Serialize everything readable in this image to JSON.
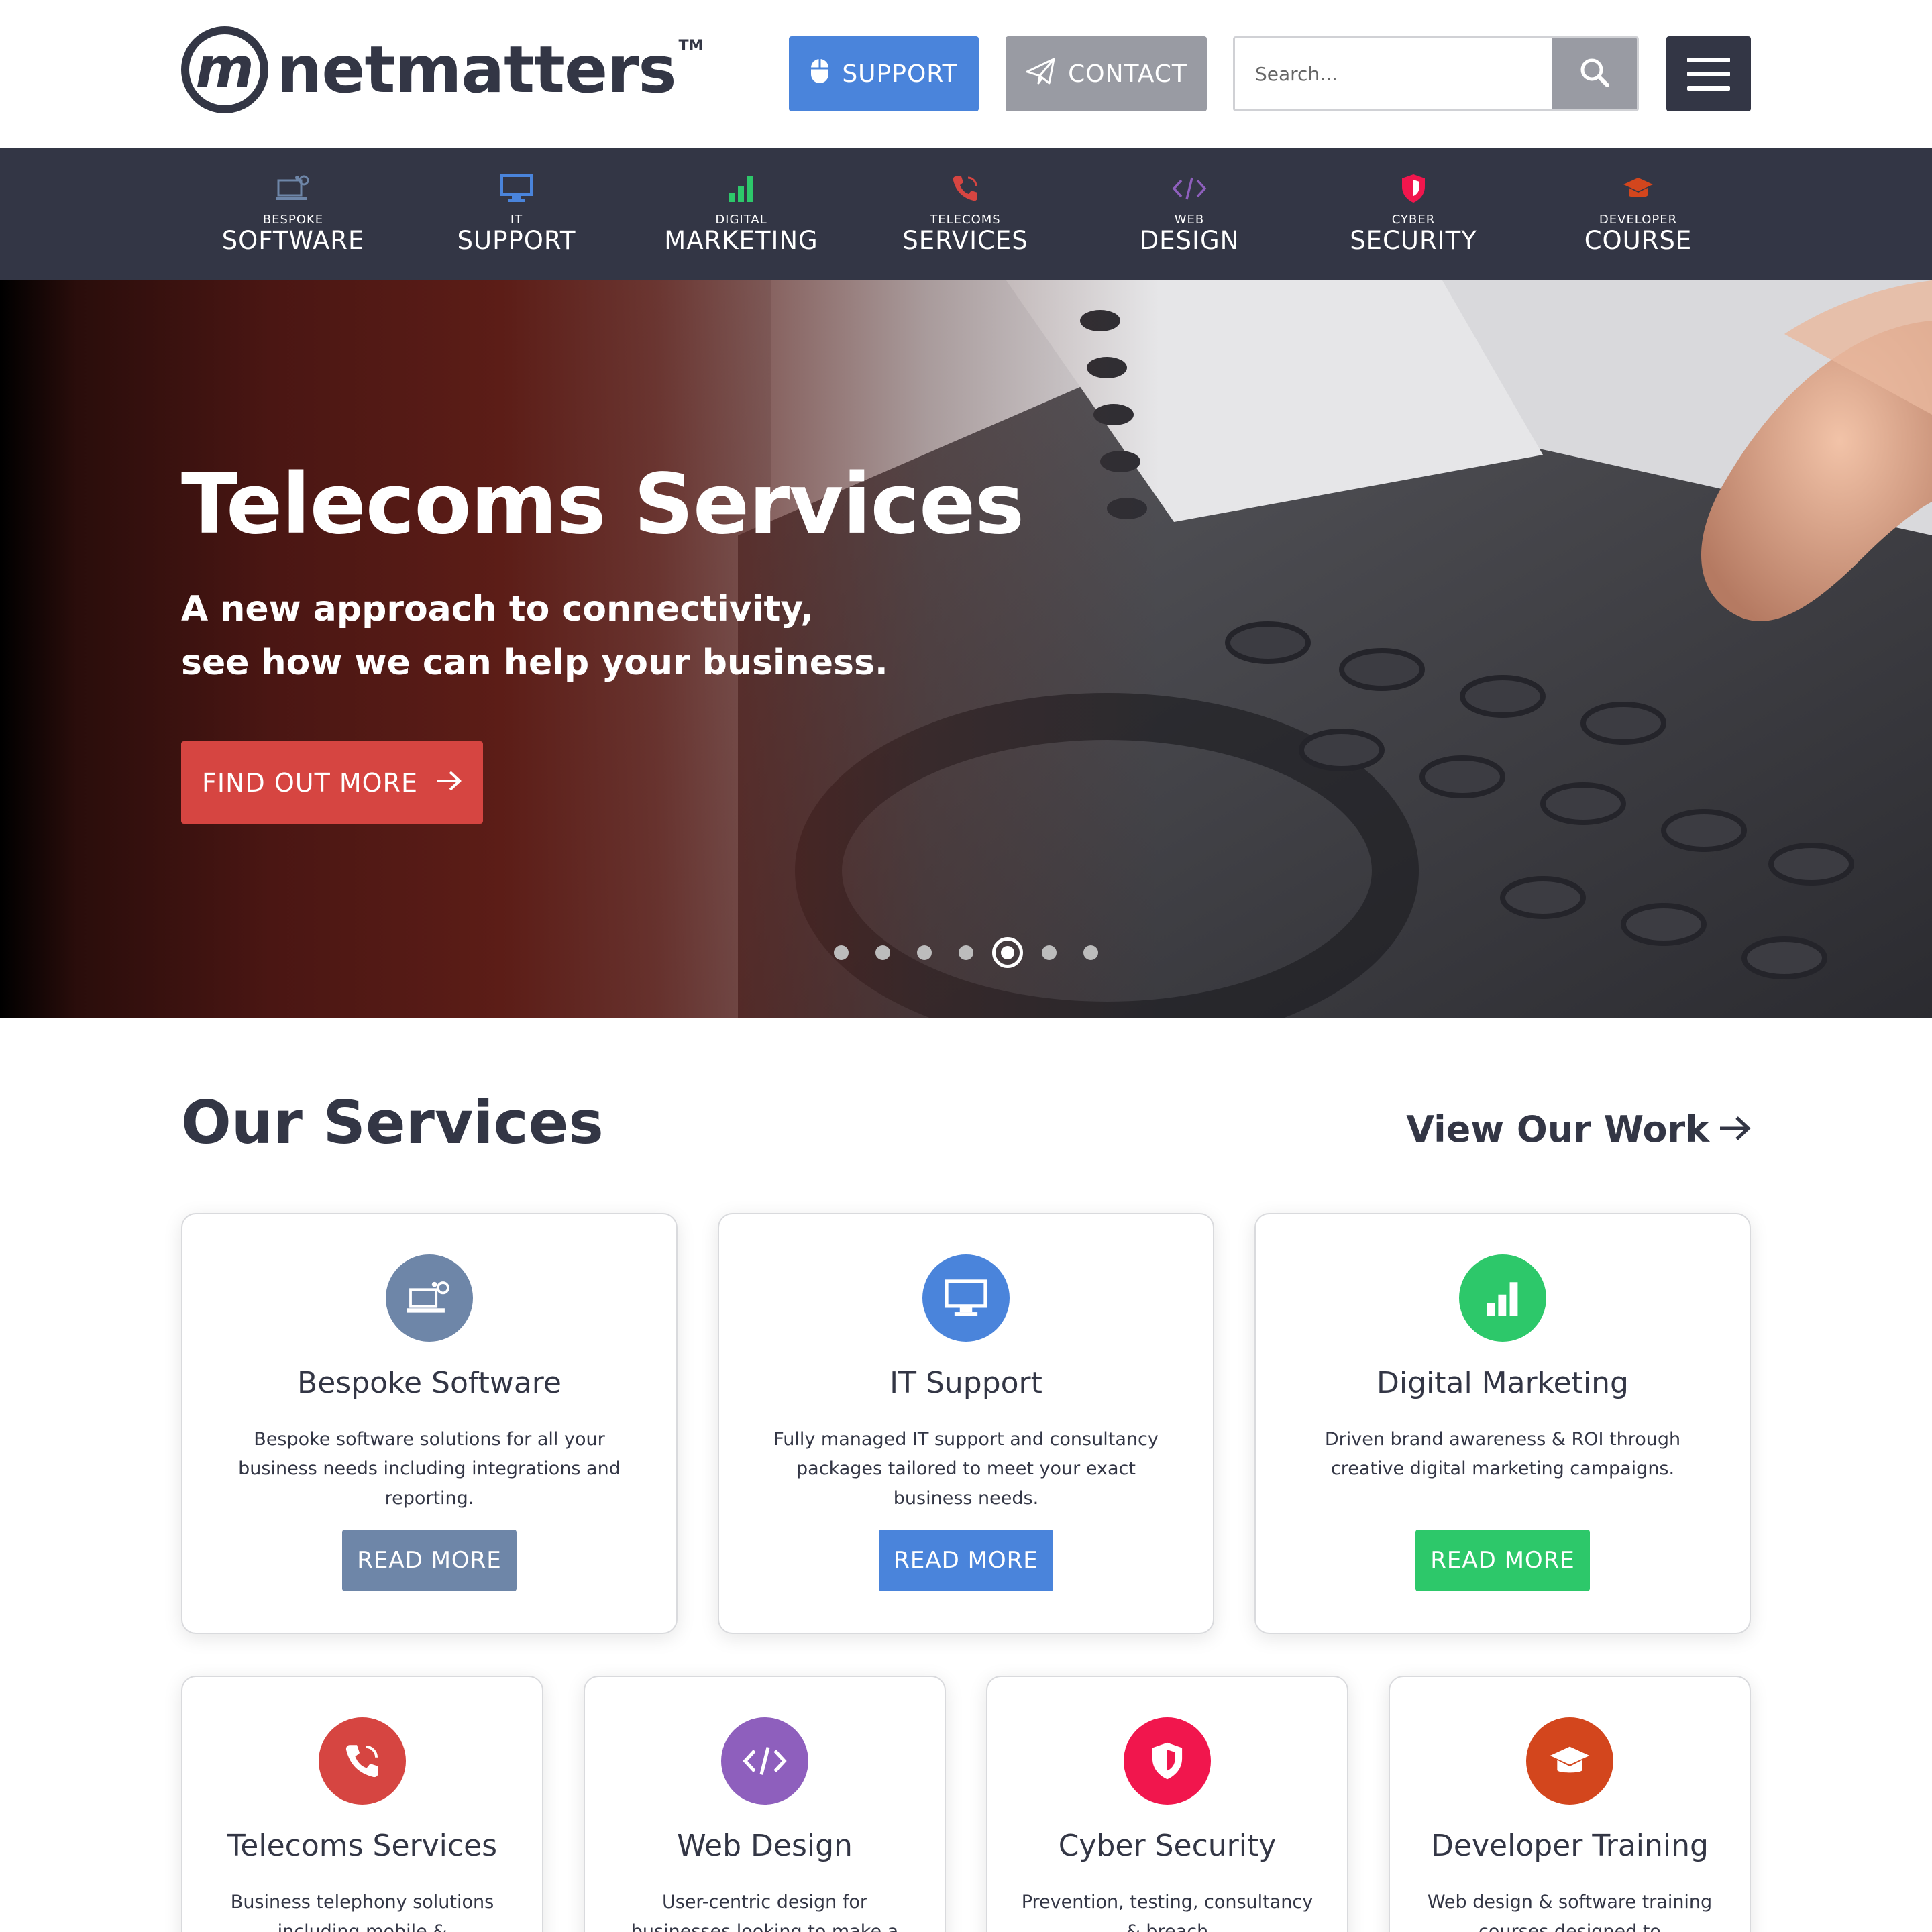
{
  "header": {
    "logo_text": "netmatters",
    "logo_mark": "m",
    "logo_tm": "TM",
    "support_label": "SUPPORT",
    "contact_label": "CONTACT",
    "search_placeholder": "Search...",
    "icons": {
      "support": "mouse-icon",
      "contact": "paper-plane-icon",
      "search": "search-icon",
      "menu": "hamburger-menu-icon"
    }
  },
  "nav": {
    "items": [
      {
        "small": "BESPOKE",
        "big": "SOFTWARE",
        "icon": "laptop-gears-icon",
        "color": "#6e86a8"
      },
      {
        "small": "IT",
        "big": "SUPPORT",
        "icon": "monitor-icon",
        "color": "#4a84db"
      },
      {
        "small": "DIGITAL",
        "big": "MARKETING",
        "icon": "bar-chart-icon",
        "color": "#2dc86a"
      },
      {
        "small": "TELECOMS",
        "big": "SERVICES",
        "icon": "phone-icon",
        "color": "#d64541"
      },
      {
        "small": "WEB",
        "big": "DESIGN",
        "icon": "code-icon",
        "color": "#8e5fbd"
      },
      {
        "small": "CYBER",
        "big": "SECURITY",
        "icon": "shield-icon",
        "color": "#f1164d"
      },
      {
        "small": "DEVELOPER",
        "big": "COURSE",
        "icon": "graduation-cap-icon",
        "color": "#d3461d"
      }
    ]
  },
  "hero": {
    "title": "Telecoms Services",
    "subtitle": "A new approach to connectivity, see how we can help your business.",
    "cta_label": "FIND OUT MORE",
    "slide_count": 7,
    "active_slide": 5
  },
  "services": {
    "title": "Our Services",
    "view_work": "View Our Work",
    "cards": [
      {
        "title": "Bespoke Software",
        "desc": "Bespoke software solutions for all your business needs including integrations and reporting.",
        "button": "READ MORE",
        "color": "#6e86a8",
        "icon": "laptop-gears-icon"
      },
      {
        "title": "IT Support",
        "desc": "Fully managed IT support and consultancy packages tailored to meet your exact business needs.",
        "button": "READ MORE",
        "color": "#4a84db",
        "icon": "monitor-icon"
      },
      {
        "title": "Digital Marketing",
        "desc": "Driven brand awareness & ROI through creative digital marketing campaigns.",
        "button": "READ MORE",
        "color": "#2dc86a",
        "icon": "bar-chart-icon"
      },
      {
        "title": "Telecoms Services",
        "desc": "Business telephony solutions including mobile &",
        "color": "#d64541",
        "icon": "phone-icon"
      },
      {
        "title": "Web Design",
        "desc": "User-centric design for businesses looking to make a",
        "color": "#8e5fbd",
        "icon": "code-icon"
      },
      {
        "title": "Cyber Security",
        "desc": "Prevention, testing, consultancy & breach",
        "color": "#f1164d",
        "icon": "shield-icon"
      },
      {
        "title": "Developer Training",
        "desc": "Web design & software training courses designed to",
        "color": "#d3461d",
        "icon": "graduation-cap-icon"
      }
    ]
  }
}
